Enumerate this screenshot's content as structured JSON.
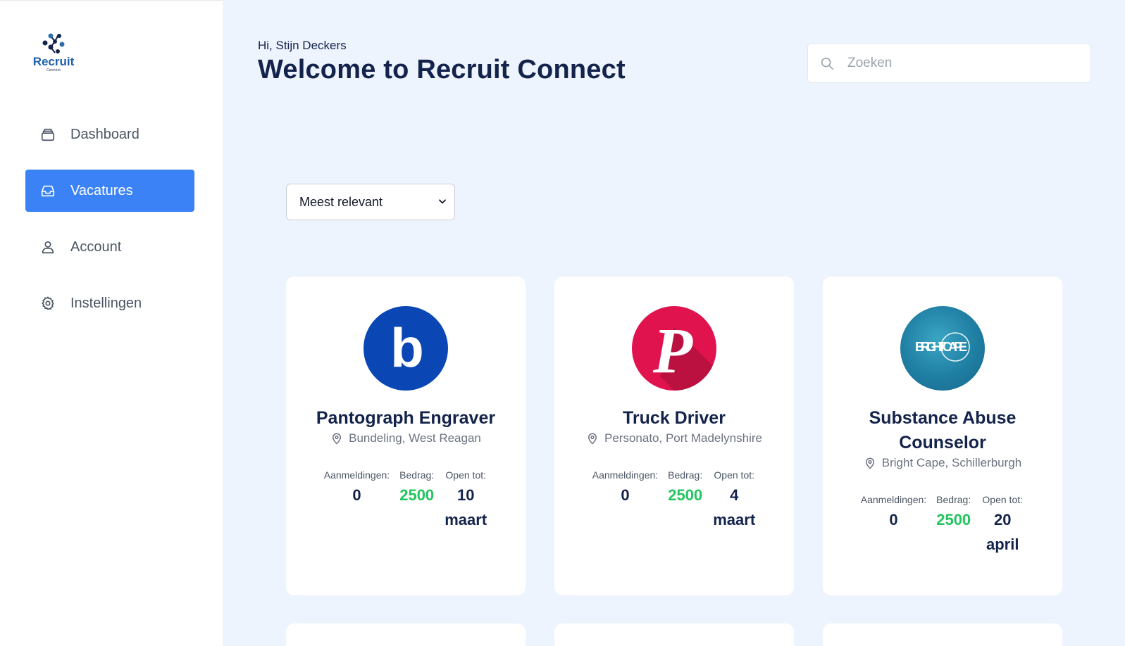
{
  "brand": {
    "name": "Recruit",
    "subtitle": "Connect",
    "accent": "#3b82f6"
  },
  "sidebar": {
    "items": [
      {
        "label": "Dashboard",
        "icon": "dashboard-icon",
        "active": false
      },
      {
        "label": "Vacatures",
        "icon": "inbox-icon",
        "active": true
      },
      {
        "label": "Account",
        "icon": "user-icon",
        "active": false
      },
      {
        "label": "Instellingen",
        "icon": "gear-icon",
        "active": false
      }
    ]
  },
  "header": {
    "greeting": "Hi, Stijn Deckers",
    "title": "Welcome to Recruit Connect"
  },
  "search": {
    "placeholder": "Zoeken",
    "value": ""
  },
  "sort": {
    "selected": "Meest relevant"
  },
  "jobs": [
    {
      "title": "Pantograph Engraver",
      "company_logo": "b",
      "location": "Bundeling, West Reagan",
      "applications_label": "Aanmeldingen:",
      "applications": "0",
      "amount_label": "Bedrag:",
      "amount": "2500",
      "open_label": "Open tot:",
      "open_until": "10 maart"
    },
    {
      "title": "Truck Driver",
      "company_logo": "P",
      "location": "Personato, Port Madelynshire",
      "applications_label": "Aanmeldingen:",
      "applications": "0",
      "amount_label": "Bedrag:",
      "amount": "2500",
      "open_label": "Open tot:",
      "open_until": "4 maart"
    },
    {
      "title": "Substance Abuse Counselor",
      "company_logo": "BRIGHT CAPE",
      "location": "Bright Cape, Schillerburgh",
      "applications_label": "Aanmeldingen:",
      "applications": "0",
      "amount_label": "Bedrag:",
      "amount": "2500",
      "open_label": "Open tot:",
      "open_until": "20 april"
    }
  ]
}
